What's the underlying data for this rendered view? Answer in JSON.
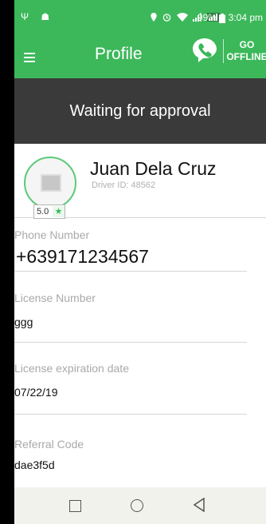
{
  "status_bar": {
    "left_icons": "Ψ ☗",
    "middle_icons": "📍 ⏰ ✈ ▂▄▆",
    "signal_text": "4G",
    "battery": "99%",
    "time": "3:04 pm"
  },
  "appbar": {
    "title": "Profile",
    "go_line1": "GO",
    "go_line2": "OFFLINE",
    "icons": [
      "hamburger-menu-icon",
      "viber-phone-icon"
    ]
  },
  "banner": {
    "text": "Waiting for approval"
  },
  "profile": {
    "name": "Juan Dela Cruz",
    "driver_id": "Driver ID: 48562",
    "rating": "5.0",
    "star": "★"
  },
  "fields": [
    {
      "label": "Phone Number",
      "value": "+639171234567"
    },
    {
      "label": "License Number",
      "value": "ggg"
    },
    {
      "label": "License expiration date",
      "value": "07/22/19"
    },
    {
      "label": "Referral Code",
      "value": "dae3f5d"
    }
  ],
  "colors": {
    "accent": "#3cb85a",
    "banner_bg": "#3a3a3a"
  }
}
